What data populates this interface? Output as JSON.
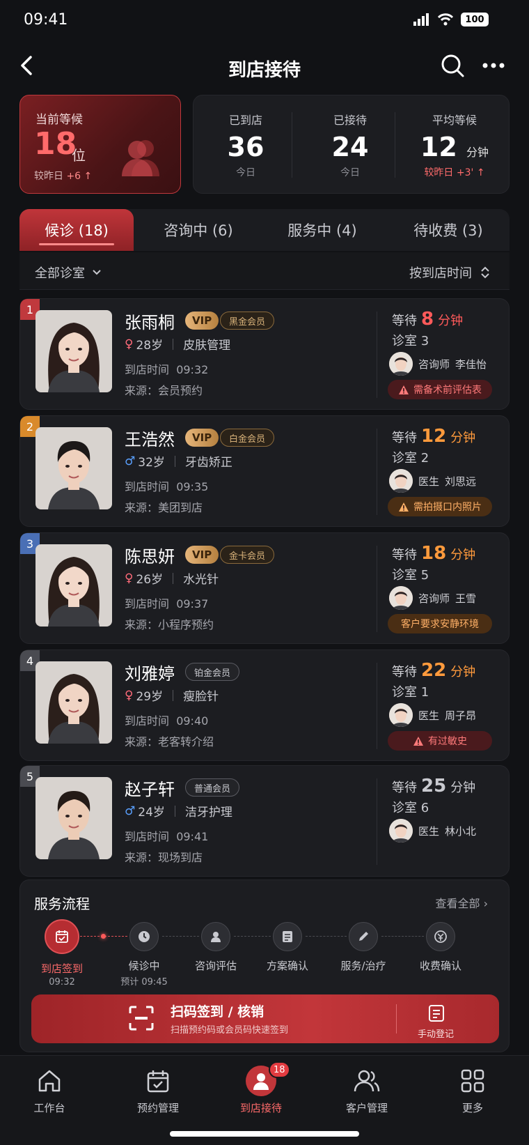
{
  "status_bar": {
    "time": "09:41",
    "battery": "100"
  },
  "header": {
    "title": "到店接待",
    "back_icon": "chevron-left-icon",
    "search_icon": "search-icon",
    "more_icon": "more-horizontal-icon"
  },
  "waiting": {
    "label": "当前等候",
    "count": "18",
    "unit": "位",
    "compare_label": "较昨日",
    "compare_value": "+6 ↑"
  },
  "stats": [
    {
      "label": "已到店",
      "value": "36",
      "unit": "",
      "sub": "今日"
    },
    {
      "label": "已接待",
      "value": "24",
      "unit": "",
      "sub": "今日"
    },
    {
      "label": "平均等候",
      "value": "12",
      "unit": "分钟",
      "sub": "较昨日 +3' ↑"
    }
  ],
  "tabs": [
    {
      "label": "候诊 (18)",
      "active": true
    },
    {
      "label": "咨询中 (6)"
    },
    {
      "label": "服务中 (4)"
    },
    {
      "label": "待收费 (3)"
    }
  ],
  "filter": {
    "room": "全部诊室",
    "sort": "按到店时间"
  },
  "patients": [
    {
      "rank": "1",
      "rank_color": "#c0393d",
      "name": "张雨桐",
      "vip": "VIP",
      "level": "黑金会员",
      "gender": "♀",
      "gender_color": "#ff6b7a",
      "age": "28岁",
      "service": "皮肤管理",
      "arrive_label": "到店时间",
      "arrive_time": "09:32",
      "source_label": "来源：",
      "source": "会员预约",
      "wait_label": "等待",
      "wait_min": "8",
      "wait_unit": "分钟",
      "wait_color": "#ff5a5a",
      "room": "诊室 3",
      "staff_role": "咨询师",
      "staff_name": "李佳怡",
      "alert": "需备术前评估表",
      "alert_type": "red"
    },
    {
      "rank": "2",
      "rank_color": "#d98a2b",
      "name": "王浩然",
      "vip": "VIP",
      "level": "白金会员",
      "gender": "♂",
      "gender_color": "#5aa0ff",
      "age": "32岁",
      "service": "牙齿矫正",
      "arrive_label": "到店时间",
      "arrive_time": "09:35",
      "source_label": "来源：",
      "source": "美团到店",
      "wait_label": "等待",
      "wait_min": "12",
      "wait_unit": "分钟",
      "wait_color": "#ff9a3c",
      "room": "诊室 2",
      "staff_role": "医生",
      "staff_name": "刘思远",
      "alert": "需拍摄口内照片",
      "alert_type": "orange"
    },
    {
      "rank": "3",
      "rank_color": "#4a6fb5",
      "name": "陈思妍",
      "vip": "VIP",
      "level": "金卡会员",
      "gender": "♀",
      "gender_color": "#ff6b7a",
      "age": "26岁",
      "service": "水光针",
      "arrive_label": "到店时间",
      "arrive_time": "09:37",
      "source_label": "来源：",
      "source": "小程序预约",
      "wait_label": "等待",
      "wait_min": "18",
      "wait_unit": "分钟",
      "wait_color": "#ff9a3c",
      "room": "诊室 5",
      "staff_role": "咨询师",
      "staff_name": "王雪",
      "alert": "客户要求安静环境",
      "alert_type": "orange"
    },
    {
      "rank": "4",
      "rank_color": "#4a4b51",
      "name": "刘雅婷",
      "vip": "",
      "level": "铂金会员",
      "gender": "♀",
      "gender_color": "#ff6b7a",
      "age": "29岁",
      "service": "瘦脸针",
      "arrive_label": "到店时间",
      "arrive_time": "09:40",
      "source_label": "来源：",
      "source": "老客转介绍",
      "wait_label": "等待",
      "wait_min": "22",
      "wait_unit": "分钟",
      "wait_color": "#ff9a3c",
      "room": "诊室 1",
      "staff_role": "医生",
      "staff_name": "周子昂",
      "alert": "有过敏史",
      "alert_type": "red"
    },
    {
      "rank": "5",
      "rank_color": "#4a4b51",
      "name": "赵子轩",
      "vip": "",
      "level": "普通会员",
      "gender": "♂",
      "gender_color": "#5aa0ff",
      "age": "24岁",
      "service": "洁牙护理",
      "arrive_label": "到店时间",
      "arrive_time": "09:41",
      "source_label": "来源：",
      "source": "现场到店",
      "wait_label": "等待",
      "wait_min": "25",
      "wait_unit": "分钟",
      "wait_color": "#c9cad0",
      "room": "诊室 6",
      "staff_role": "医生",
      "staff_name": "林小北",
      "alert": "",
      "alert_type": ""
    }
  ],
  "flow": {
    "title": "服务流程",
    "view_all": "查看全部",
    "steps": [
      {
        "label": "到店签到",
        "sub": "09:32",
        "icon": "calendar-check-icon",
        "active": true
      },
      {
        "label": "候诊中",
        "sub": "预计 09:45",
        "icon": "clock-icon"
      },
      {
        "label": "咨询评估",
        "sub": "",
        "icon": "user-icon"
      },
      {
        "label": "方案确认",
        "sub": "",
        "icon": "document-icon"
      },
      {
        "label": "服务/治疗",
        "sub": "",
        "icon": "pen-icon"
      },
      {
        "label": "收费确认",
        "sub": "",
        "icon": "yuan-icon"
      }
    ]
  },
  "scan": {
    "title": "扫码签到 / 核销",
    "subtitle": "扫描预约码或会员码快速签到",
    "manual": "手动登记"
  },
  "bottom_nav": [
    {
      "label": "工作台",
      "icon": "home-icon"
    },
    {
      "label": "预约管理",
      "icon": "calendar-icon"
    },
    {
      "label": "到店接待",
      "icon": "user-icon",
      "active": true,
      "badge": "18"
    },
    {
      "label": "客户管理",
      "icon": "users-icon"
    },
    {
      "label": "更多",
      "icon": "grid-icon"
    }
  ],
  "colors": {
    "accent": "#c0353a",
    "accent_text": "#ff6b6b",
    "bg": "#111215",
    "card": "#1c1d21"
  }
}
